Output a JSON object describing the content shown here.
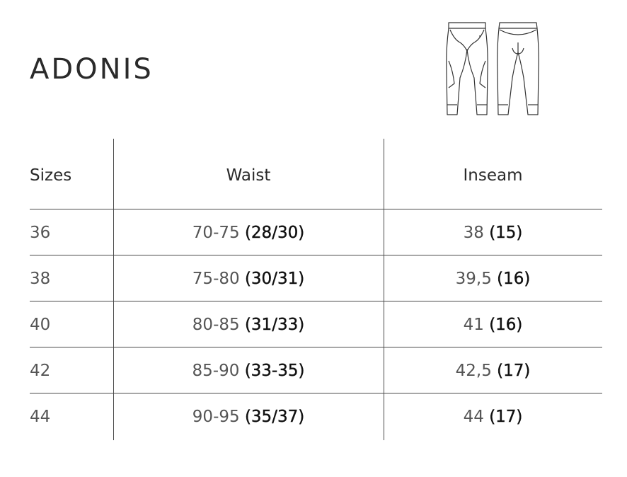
{
  "product": {
    "title": "ADONIS"
  },
  "garment_illustration": {
    "icon": "leggings-front-back-icon"
  },
  "table": {
    "headers": {
      "sizes": "Sizes",
      "waist": "Waist",
      "inseam": "Inseam"
    },
    "rows": [
      {
        "size": "36",
        "waist_cm": "70-75",
        "waist_in": "(28/30)",
        "inseam_cm": "38",
        "inseam_in": "(15)"
      },
      {
        "size": "38",
        "waist_cm": "75-80",
        "waist_in": "(30/31)",
        "inseam_cm": "39,5",
        "inseam_in": "(16)"
      },
      {
        "size": "40",
        "waist_cm": "80-85",
        "waist_in": "(31/33)",
        "inseam_cm": "41",
        "inseam_in": "(16)"
      },
      {
        "size": "42",
        "waist_cm": "85-90",
        "waist_in": "(33-35)",
        "inseam_cm": "42,5",
        "inseam_in": "(17)"
      },
      {
        "size": "44",
        "waist_cm": "90-95",
        "waist_in": "(35/37)",
        "inseam_cm": "44",
        "inseam_in": "(17)"
      }
    ]
  }
}
